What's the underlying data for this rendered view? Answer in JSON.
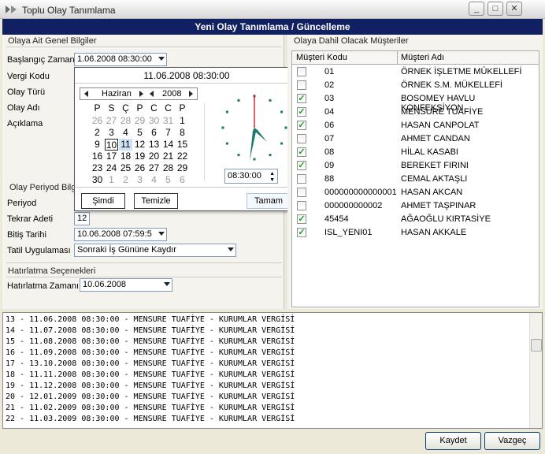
{
  "window": {
    "title": "Toplu Olay Tanımlama",
    "minimize": "_",
    "maximize": "□",
    "close": "✕"
  },
  "banner": "Yeni Olay Tanımlama / Güncelleme",
  "general": {
    "section": "Olaya Ait Genel Bilgiler",
    "start_label": "Başlangıç Zamanı",
    "start_value": "1.06.2008 08:30:00",
    "tax_label": "Vergi Kodu",
    "type_label": "Olay Türü",
    "name_label": "Olay Adı",
    "desc_label": "Açıklama"
  },
  "period": {
    "section": "Olay Periyod Bilgi",
    "period_label": "Periyod",
    "repeat_label": "Tekrar Adeti",
    "repeat_value": "12",
    "end_label": "Bitiş Tarihi",
    "end_value": "10.06.2008 07:59:5",
    "holiday_label": "Tatil Uygulaması",
    "holiday_value": "Sonraki İş Gününe Kaydır"
  },
  "reminder": {
    "section": "Hatırlatma Seçenekleri",
    "time_label": "Hatırlatma Zamanı",
    "time_value": "10.06.2008"
  },
  "calendar": {
    "header": "11.06.2008 08:30:00",
    "month": "Haziran",
    "year": "2008",
    "weekdays": [
      "P",
      "S",
      "Ç",
      "P",
      "C",
      "C",
      "P"
    ],
    "weeks": [
      [
        "26",
        "27",
        "28",
        "29",
        "30",
        "31",
        "1"
      ],
      [
        "2",
        "3",
        "4",
        "5",
        "6",
        "7",
        "8"
      ],
      [
        "9",
        "10",
        "11",
        "12",
        "13",
        "14",
        "15"
      ],
      [
        "16",
        "17",
        "18",
        "19",
        "20",
        "21",
        "22"
      ],
      [
        "23",
        "24",
        "25",
        "26",
        "27",
        "28",
        "29"
      ],
      [
        "30",
        "1",
        "2",
        "3",
        "4",
        "5",
        "6"
      ]
    ],
    "time": "08:30:00",
    "now_button": "Şimdi",
    "clear_button": "Temizle",
    "ok_button": "Tamam",
    "colors": {
      "hour_hand": "#1a7a6a",
      "second_hand": "#d02020",
      "selected": "#cfe3f6"
    }
  },
  "customers": {
    "section": "Olaya Dahil Olacak Müşteriler",
    "col_code": "Müşteri Kodu",
    "col_name": "Müşteri Adı",
    "rows": [
      {
        "checked": false,
        "code": "01",
        "name": "ÖRNEK İŞLETME MÜKELLEFİ"
      },
      {
        "checked": false,
        "code": "02",
        "name": "ÖRNEK S.M. MÜKELLEFİ"
      },
      {
        "checked": true,
        "code": "03",
        "name": "BOSOMEY HAVLU KONFEKSİYON"
      },
      {
        "checked": true,
        "code": "04",
        "name": "MENSURE TUAFİYE"
      },
      {
        "checked": true,
        "code": "06",
        "name": "HASAN CANPOLAT"
      },
      {
        "checked": false,
        "code": "07",
        "name": "AHMET CANDAN"
      },
      {
        "checked": true,
        "code": "08",
        "name": "HİLAL KASABI"
      },
      {
        "checked": true,
        "code": "09",
        "name": "BEREKET FIRINI"
      },
      {
        "checked": false,
        "code": "88",
        "name": "CEMAL AKTAŞLI"
      },
      {
        "checked": false,
        "code": "000000000000001",
        "name": "HASAN AKCAN"
      },
      {
        "checked": false,
        "code": "000000000002",
        "name": "AHMET TAŞPINAR"
      },
      {
        "checked": true,
        "code": "45454",
        "name": "AĞAOĞLU KIRTASİYE"
      },
      {
        "checked": true,
        "code": "ISL_YENI01",
        "name": "HASAN AKKALE"
      }
    ]
  },
  "log": [
    "13 - 11.06.2008 08:30:00 - MENSURE TUAFİYE - KURUMLAR VERGİSİ",
    "14 - 11.07.2008 08:30:00 - MENSURE TUAFİYE - KURUMLAR VERGİSİ",
    "15 - 11.08.2008 08:30:00 - MENSURE TUAFİYE - KURUMLAR VERGİSİ",
    "16 - 11.09.2008 08:30:00 - MENSURE TUAFİYE - KURUMLAR VERGİSİ",
    "17 - 13.10.2008 08:30:00 - MENSURE TUAFİYE - KURUMLAR VERGİSİ",
    "18 - 11.11.2008 08:30:00 - MENSURE TUAFİYE - KURUMLAR VERGİSİ",
    "19 - 11.12.2008 08:30:00 - MENSURE TUAFİYE - KURUMLAR VERGİSİ",
    "20 - 12.01.2009 08:30:00 - MENSURE TUAFİYE - KURUMLAR VERGİSİ",
    "21 - 11.02.2009 08:30:00 - MENSURE TUAFİYE - KURUMLAR VERGİSİ",
    "22 - 11.03.2009 08:30:00 - MENSURE TUAFİYE - KURUMLAR VERGİSİ"
  ],
  "footer": {
    "save": "Kaydet",
    "cancel": "Vazgeç"
  }
}
